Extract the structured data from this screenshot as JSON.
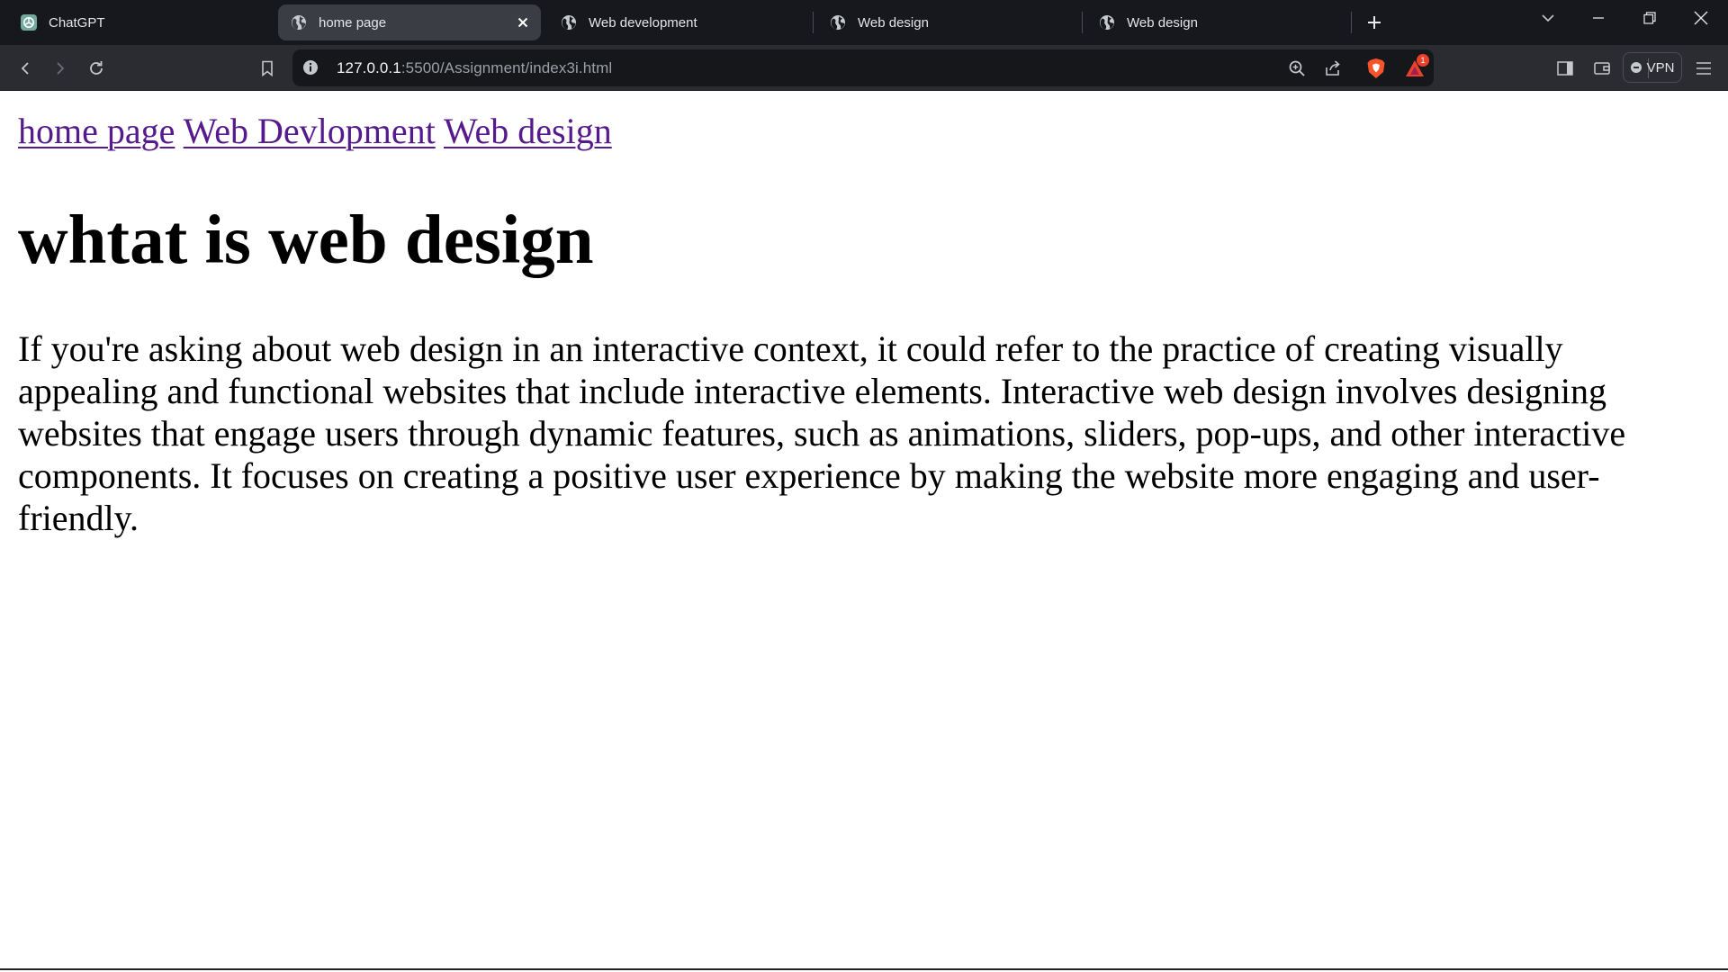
{
  "browser": {
    "tabs": [
      {
        "title": "ChatGPT",
        "favicon": "chatgpt-icon",
        "active": false
      },
      {
        "title": "home page",
        "favicon": "globe-icon",
        "active": true
      },
      {
        "title": "Web development",
        "favicon": "globe-icon",
        "active": false
      },
      {
        "title": "Web design",
        "favicon": "globe-icon",
        "active": false
      },
      {
        "title": "Web design",
        "favicon": "globe-icon",
        "active": false
      }
    ],
    "address": {
      "host": "127.0.0.1",
      "path": ":5500/Assignment/index3i.html"
    },
    "rewards_badge": "1",
    "vpn_label": "VPN",
    "colors": {
      "tabstrip_bg": "#16181d",
      "toolbar_bg": "#2a2c31",
      "active_tab_bg": "#3a3d44",
      "brave_orange": "#fb542b",
      "visited_link": "#551a8b"
    }
  },
  "page": {
    "nav_links": [
      "home page",
      "Web Devlopment",
      "Web design"
    ],
    "heading": "whtat is web design",
    "paragraph": "If you're asking about web design in an interactive context, it could refer to the practice of creating visually appealing and functional websites that include interactive elements. Interactive web design involves designing websites that engage users through dynamic features, such as animations, sliders, pop-ups, and other interactive components. It focuses on creating a positive user experience by making the website more engaging and user-friendly."
  }
}
